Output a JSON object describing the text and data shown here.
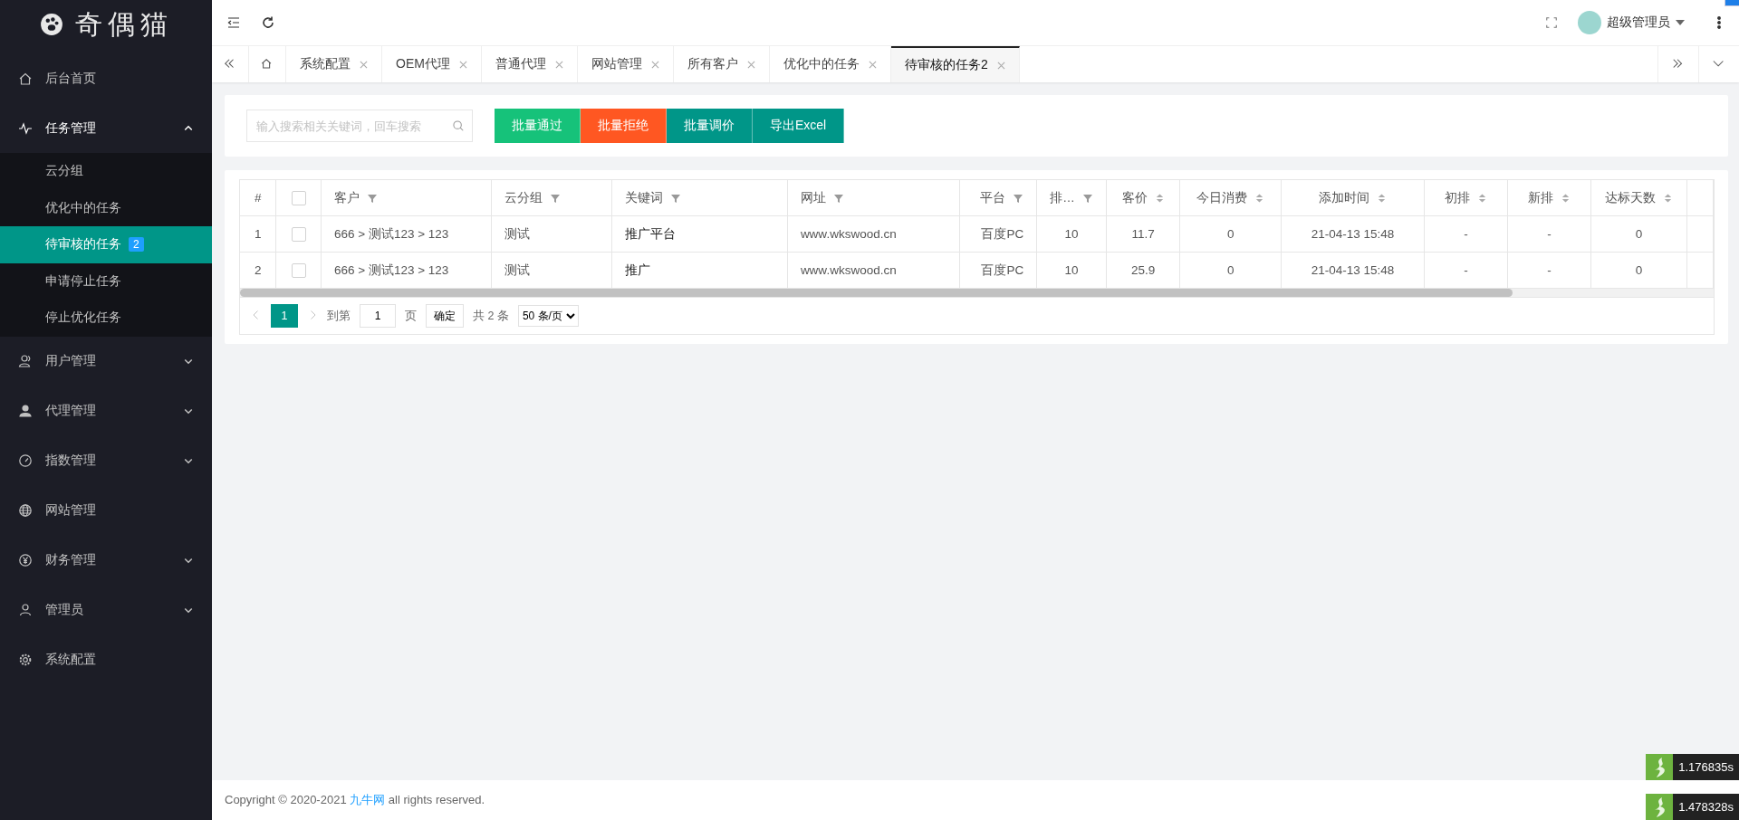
{
  "logo": {
    "text": "奇偶猫"
  },
  "sidebar": {
    "items": [
      {
        "label": "后台首页",
        "kind": "link",
        "selected": false
      },
      {
        "label": "任务管理",
        "kind": "group",
        "expanded": true,
        "selected": false,
        "children": [
          {
            "label": "云分组",
            "selected": false
          },
          {
            "label": "优化中的任务",
            "selected": false
          },
          {
            "label": "待审核的任务",
            "selected": true,
            "badge": "2"
          },
          {
            "label": "申请停止任务",
            "selected": false
          },
          {
            "label": "停止优化任务",
            "selected": false
          }
        ]
      },
      {
        "label": "用户管理",
        "kind": "group",
        "expanded": false,
        "selected": false
      },
      {
        "label": "代理管理",
        "kind": "group",
        "expanded": false,
        "selected": false
      },
      {
        "label": "指数管理",
        "kind": "group",
        "expanded": false,
        "selected": false
      },
      {
        "label": "网站管理",
        "kind": "link",
        "selected": false
      },
      {
        "label": "财务管理",
        "kind": "group",
        "expanded": false,
        "selected": false
      },
      {
        "label": "管理员",
        "kind": "group",
        "expanded": false,
        "selected": false
      },
      {
        "label": "系统配置",
        "kind": "link",
        "selected": false
      }
    ]
  },
  "header": {
    "user": "超级管理员"
  },
  "tabs": [
    {
      "label": "系统配置",
      "selected": false
    },
    {
      "label": "OEM代理",
      "selected": false
    },
    {
      "label": "普通代理",
      "selected": false
    },
    {
      "label": "网站管理",
      "selected": false
    },
    {
      "label": "所有客户",
      "selected": false
    },
    {
      "label": "优化中的任务",
      "selected": false
    },
    {
      "label": "待审核的任务2",
      "selected": true
    }
  ],
  "toolbar": {
    "search": {
      "placeholder": "输入搜索相关关键词，回车搜索"
    },
    "buttons": [
      {
        "label": "批量通过",
        "color": "#16c27a"
      },
      {
        "label": "批量拒绝",
        "color": "#ff5722"
      },
      {
        "label": "批量调价",
        "color": "#009688"
      },
      {
        "label": "导出Excel",
        "color": "#009688"
      }
    ]
  },
  "table": {
    "all_checked": false,
    "columns": [
      {
        "label": "#",
        "kind": "plain"
      },
      {
        "label": "客户",
        "kind": "filter"
      },
      {
        "label": "云分组",
        "kind": "filter"
      },
      {
        "label": "关键词",
        "kind": "filter"
      },
      {
        "label": "网址",
        "kind": "filter"
      },
      {
        "label": "平台",
        "kind": "filter"
      },
      {
        "label": "排…",
        "kind": "filter"
      },
      {
        "label": "客价",
        "kind": "sort"
      },
      {
        "label": "今日消费",
        "kind": "sort"
      },
      {
        "label": "添加时间",
        "kind": "sort"
      },
      {
        "label": "初排",
        "kind": "sort"
      },
      {
        "label": "新排",
        "kind": "sort"
      },
      {
        "label": "达标天数",
        "kind": "sort"
      }
    ],
    "rows": [
      {
        "checked": false,
        "cells": [
          "1",
          "666 > 测试123 > 123",
          "测试",
          "推广平台",
          "www.wkswood.cn",
          "百度PC",
          "10",
          "11.7",
          "0",
          "21-04-13 15:48",
          "-",
          "-",
          "0"
        ]
      },
      {
        "checked": false,
        "cells": [
          "2",
          "666 > 测试123 > 123",
          "测试",
          "推广",
          "www.wkswood.cn",
          "百度PC",
          "10",
          "25.9",
          "0",
          "21-04-13 15:48",
          "-",
          "-",
          "0"
        ]
      }
    ]
  },
  "pagination": {
    "pages": [
      {
        "label": "1",
        "selected": true
      }
    ],
    "goto_label": "到第",
    "page_input": "1",
    "page_unit": "页",
    "confirm": "确定",
    "total": "共 2 条",
    "page_size": "50 条/页"
  },
  "footer": {
    "before": "Copyright © 2020-2021",
    "link": "九牛网",
    "after": "all rights reserved."
  },
  "timers": [
    {
      "value": "1.176835s"
    },
    {
      "value": "1.478328s"
    }
  ]
}
